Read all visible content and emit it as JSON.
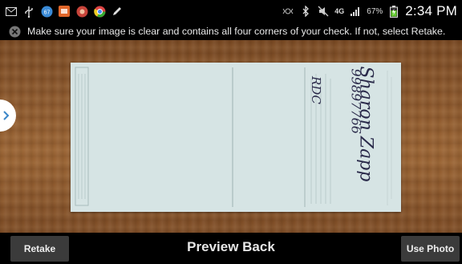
{
  "status_bar": {
    "left_icons": [
      "mail-icon",
      "usb-icon",
      "notification-67-icon",
      "app-orange-icon",
      "app-red-icon",
      "chrome-icon",
      "pen-icon"
    ],
    "notification_count": "67",
    "battery_percent": "67%",
    "network_label": "4G",
    "time": "2:34 PM"
  },
  "notice": {
    "text": "Make sure your image is clear and contains all four corners of your check. If not, select Retake."
  },
  "preview": {
    "check_handwriting": {
      "signature": "Sharon Zapp",
      "account": "99897766",
      "note": "RDC"
    }
  },
  "bottom_bar": {
    "retake_label": "Retake",
    "title": "Preview Back",
    "use_photo_label": "Use Photo"
  }
}
